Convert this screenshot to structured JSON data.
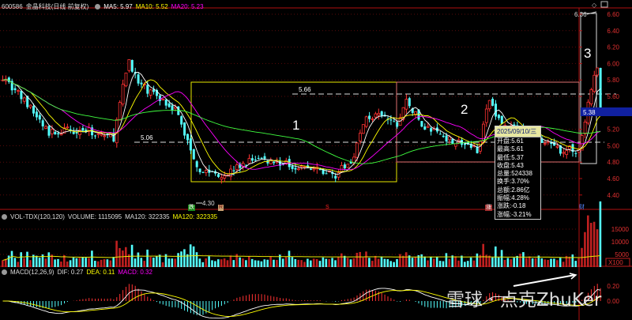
{
  "header": {
    "code": "600586",
    "name": "金晶科技(日线 前复权)",
    "ma5": "MA5: 5.97",
    "ma10": "MA10: 5.52",
    "ma20": "MA20: 5.23"
  },
  "volume_header": {
    "title": "VOL-TDX(120,120)",
    "volume": "VOLUME: 1115095",
    "ma120a": "MA120: 322335",
    "ma120b": "MA120: 322335"
  },
  "macd_header": {
    "title": "MACD(12,26,9)",
    "dif": "DIF: 0.27",
    "dea": "DEA: 0.11",
    "macd": "MACD: 0.32"
  },
  "tooltip": {
    "date": "2025/09/10/三",
    "rows": [
      "开盘:5.61",
      "最高:5.61",
      "最低:5.37",
      "收盘:5.43",
      "总量:524338",
      "换手:3.70%",
      "总额:2.86亿",
      "振幅:4.28%",
      "涨跌:-0.18",
      "涨幅:-3.21%"
    ]
  },
  "price_axis": [
    "6.60",
    "6.40",
    "6.20",
    "6.00",
    "5.80",
    "5.60",
    "5.20",
    "5.00",
    "4.80",
    "4.60",
    "4.40"
  ],
  "current_price": "5.38",
  "volume_axis": [
    "15000",
    "10000",
    "5000"
  ],
  "volume_unit": "X100",
  "macd_axis": [
    "0.20",
    "0.00"
  ],
  "annotations": {
    "box1": "1",
    "box2": "2",
    "box3": "3",
    "level_high": "5.66",
    "level_low": "5.06",
    "low_mark": "4.30",
    "high_mark": "6.36"
  },
  "markers": [
    "跌",
    "R",
    "S",
    "涨",
    "财"
  ],
  "watermark": "雪球 · 点克ZhuKer",
  "colors": {
    "up": "#ff3232",
    "down": "#54ffff",
    "ma5": "#ffffff",
    "ma10": "#ffff00",
    "ma20": "#ff00ff",
    "axis": "#b01010"
  },
  "chart_data": {
    "type": "candlestick",
    "title": "600586 金晶科技 日线 前复权",
    "price_range": [
      4.3,
      6.65
    ],
    "candle_count": 188,
    "price_path": [
      [
        0,
        5.85
      ],
      [
        8,
        5.5
      ],
      [
        15,
        5.15
      ],
      [
        25,
        5.2
      ],
      [
        36,
        5.1
      ],
      [
        39,
        5.7
      ],
      [
        41,
        6.05
      ],
      [
        44,
        5.75
      ],
      [
        50,
        5.6
      ],
      [
        56,
        5.45
      ],
      [
        61,
        4.95
      ],
      [
        64,
        4.7
      ],
      [
        72,
        4.65
      ],
      [
        82,
        4.85
      ],
      [
        92,
        4.78
      ],
      [
        108,
        4.65
      ],
      [
        113,
        4.8
      ],
      [
        118,
        5.35
      ],
      [
        123,
        5.35
      ],
      [
        128,
        5.25
      ],
      [
        131,
        5.55
      ],
      [
        136,
        5.25
      ],
      [
        144,
        5.1
      ],
      [
        154,
        4.95
      ],
      [
        158,
        5.55
      ],
      [
        162,
        5.25
      ],
      [
        170,
        5.15
      ],
      [
        175,
        5.05
      ],
      [
        180,
        4.95
      ],
      [
        187,
        4.95
      ],
      [
        189,
        5.3
      ],
      [
        191,
        5.7
      ],
      [
        193,
        5.95
      ],
      [
        194,
        5.43
      ]
    ],
    "levels": [
      5.66,
      5.06
    ],
    "low": 4.3,
    "high": 6.36
  }
}
